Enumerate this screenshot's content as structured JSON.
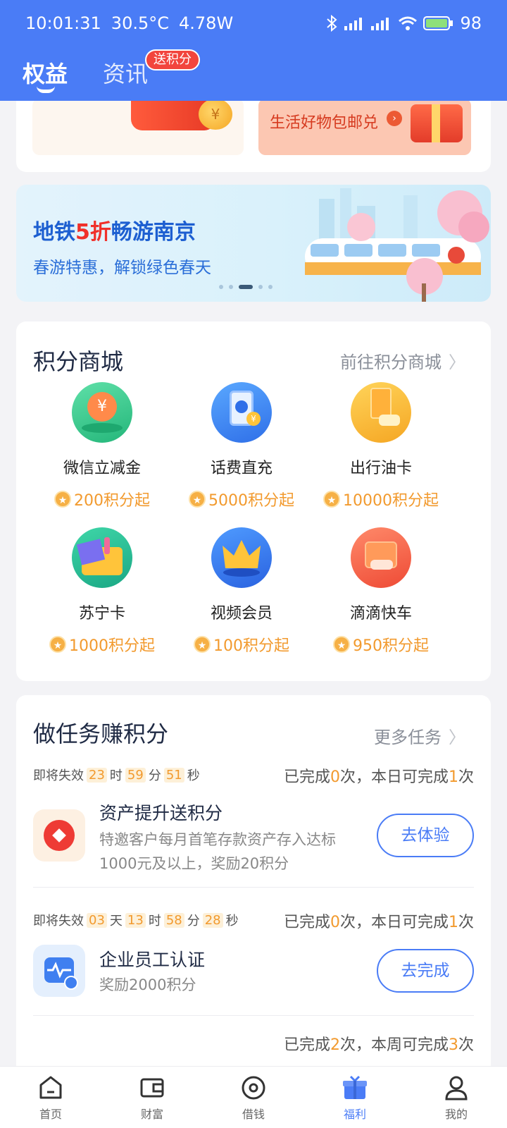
{
  "status_bar": {
    "time": "10:01:31",
    "temperature": "30.5°C",
    "power": "4.78W",
    "battery": "98"
  },
  "tabs": [
    {
      "label": "权益",
      "active": true
    },
    {
      "label": "资讯",
      "active": false,
      "badge": "送积分"
    }
  ],
  "promo": {
    "right_text": "生活好物包邮兑"
  },
  "banner": {
    "title_pre": "地铁",
    "title_highlight": "5折",
    "title_post": "畅游南京",
    "subtitle": "春游特惠，解锁绿色春天",
    "page_count": 5,
    "active_page": 3
  },
  "shop": {
    "title": "积分商城",
    "link": "前往积分商城",
    "items": [
      {
        "name": "微信立减金",
        "points": "200积分起",
        "icon": "wechat-coupon-icon"
      },
      {
        "name": "话费直充",
        "points": "5000积分起",
        "icon": "phone-bill-icon"
      },
      {
        "name": "出行油卡",
        "points": "10000积分起",
        "icon": "fuel-card-icon"
      },
      {
        "name": "苏宁卡",
        "points": "1000积分起",
        "icon": "suning-card-icon"
      },
      {
        "name": "视频会员",
        "points": "100积分起",
        "icon": "video-vip-icon"
      },
      {
        "name": "滴滴快车",
        "points": "950积分起",
        "icon": "didi-ride-icon"
      }
    ]
  },
  "tasks": {
    "title": "做任务赚积分",
    "link": "更多任务",
    "items": [
      {
        "expire_label": "即将失效",
        "countdown": [
          {
            "v": "23",
            "u": "时"
          },
          {
            "v": "59",
            "u": "分"
          },
          {
            "v": "51",
            "u": "秒"
          }
        ],
        "progress_pre": "已完成",
        "done": "0",
        "progress_mid": "次，本日可完成",
        "limit": "1",
        "progress_post": "次",
        "title": "资产提升送积分",
        "desc": "特邀客户每月首笔存款资产存入达标1000元及以上，奖励20积分",
        "button": "去体验"
      },
      {
        "expire_label": "即将失效",
        "countdown": [
          {
            "v": "03",
            "u": "天"
          },
          {
            "v": "13",
            "u": "时"
          },
          {
            "v": "58",
            "u": "分"
          },
          {
            "v": "28",
            "u": "秒"
          }
        ],
        "progress_pre": "已完成",
        "done": "0",
        "progress_mid": "次，本日可完成",
        "limit": "1",
        "progress_post": "次",
        "title": "企业员工认证",
        "desc": "奖励2000积分",
        "button": "去完成"
      },
      {
        "progress_pre": "已完成",
        "done": "2",
        "progress_mid": "次，本周可完成",
        "limit": "3",
        "progress_post": "次"
      }
    ]
  },
  "nav": [
    {
      "label": "首页",
      "icon": "home-icon"
    },
    {
      "label": "财富",
      "icon": "wallet-icon"
    },
    {
      "label": "借钱",
      "icon": "loan-icon"
    },
    {
      "label": "福利",
      "icon": "gift-icon",
      "active": true
    },
    {
      "label": "我的",
      "icon": "profile-icon"
    }
  ],
  "colors": {
    "primary": "#4a7cf6",
    "accent_orange": "#f29a2e",
    "badge_red": "#f2453d",
    "banner_blue": "#1d5fd1"
  }
}
